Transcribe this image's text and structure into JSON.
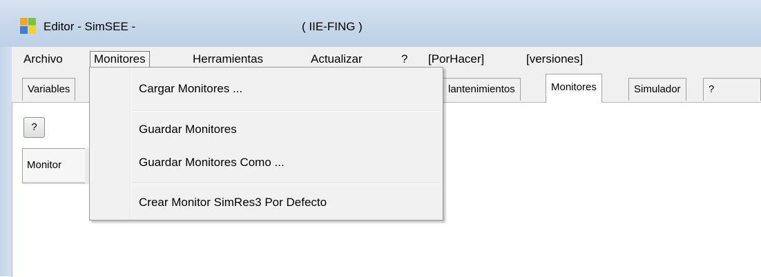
{
  "window": {
    "title_app": "Editor - SimSEE -",
    "title_org": "( IIE-FING )"
  },
  "menubar": {
    "items": [
      {
        "label": "Archivo"
      },
      {
        "label": "Monitores"
      },
      {
        "label": "Herramientas"
      },
      {
        "label": "Actualizar"
      },
      {
        "label": "?"
      },
      {
        "label": "[PorHacer]"
      },
      {
        "label": "[versiones]"
      }
    ]
  },
  "tabs": {
    "items": [
      {
        "label": "Variables"
      },
      {
        "label": "lantenimientos"
      },
      {
        "label": "Monitores"
      },
      {
        "label": "Simulador"
      },
      {
        "label": "?"
      }
    ]
  },
  "panel": {
    "help_button": "?",
    "inner_tab": "Monitor"
  },
  "dropdown": {
    "items": [
      {
        "label": "Cargar Monitores ..."
      },
      {
        "label": "Guardar Monitores"
      },
      {
        "label": "Guardar Monitores Como ..."
      },
      {
        "label": "Crear Monitor SimRes3 Por Defecto"
      }
    ]
  },
  "colors": {
    "icon_orange": "#f5a623",
    "icon_green": "#7cc242",
    "icon_blue": "#3a7fd4",
    "icon_yellow": "#f2d230"
  }
}
